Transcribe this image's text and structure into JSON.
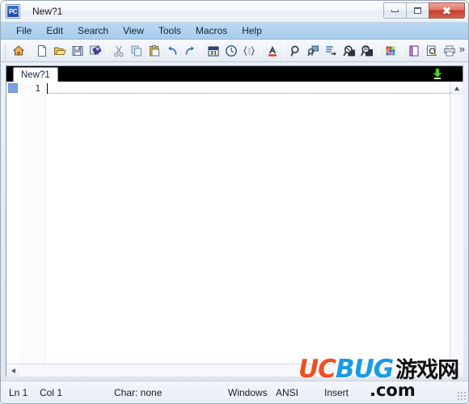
{
  "window": {
    "title": "New?1",
    "app_icon_label": "PC",
    "controls": [
      {
        "name": "minimize",
        "glyph": "minimize-icon"
      },
      {
        "name": "maximize",
        "glyph": "maximize-icon"
      },
      {
        "name": "close",
        "glyph": "✖"
      }
    ]
  },
  "menubar": {
    "items": [
      {
        "label": "File"
      },
      {
        "label": "Edit"
      },
      {
        "label": "Search"
      },
      {
        "label": "View"
      },
      {
        "label": "Tools"
      },
      {
        "label": "Macros"
      },
      {
        "label": "Help"
      }
    ]
  },
  "toolbar": {
    "overflow_label": "»",
    "groups": [
      {
        "buttons": [
          {
            "icon": "home-icon",
            "color": "#e8a33d"
          }
        ]
      },
      {
        "buttons": [
          {
            "icon": "new-file-icon",
            "color": "#ffffff"
          },
          {
            "icon": "open-folder-icon",
            "color": "#f2c14e"
          },
          {
            "icon": "save-icon",
            "color": "#8fa0b5"
          },
          {
            "icon": "save-all-icon",
            "color": "#4a3fa8"
          }
        ]
      },
      {
        "buttons": [
          {
            "icon": "cut-icon",
            "color": "#9aa3ae"
          },
          {
            "icon": "copy-icon",
            "color": "#7fa8d0"
          },
          {
            "icon": "paste-icon",
            "color": "#e0b54a"
          },
          {
            "icon": "undo-icon",
            "color": "#3a6fb5"
          },
          {
            "icon": "redo-icon",
            "color": "#3a6fb5"
          }
        ]
      },
      {
        "buttons": [
          {
            "icon": "calendar-icon",
            "color": "#2a4a8a"
          },
          {
            "icon": "clock-icon",
            "color": "#2a4a8a"
          },
          {
            "icon": "format-code-icon",
            "color": "#5a6a80"
          }
        ]
      },
      {
        "buttons": [
          {
            "icon": "text-color-icon",
            "color": "#d43f2a"
          }
        ]
      },
      {
        "buttons": [
          {
            "icon": "find-icon",
            "color": "#33404f"
          },
          {
            "icon": "find-in-files-icon",
            "color": "#4a7fc0"
          },
          {
            "icon": "goto-line-icon",
            "color": "#3a6fb5"
          },
          {
            "icon": "find-next-icon",
            "color": "#2b3542"
          },
          {
            "icon": "replace-icon",
            "color": "#2b3542"
          }
        ]
      },
      {
        "buttons": [
          {
            "icon": "color-palette-icon",
            "color": "#d43f2a"
          }
        ]
      },
      {
        "buttons": [
          {
            "icon": "page-setup-icon",
            "color": "#8a4fb5"
          },
          {
            "icon": "print-preview-icon",
            "color": "#5a6a80"
          },
          {
            "icon": "print-icon",
            "color": "#5a6a80"
          }
        ]
      }
    ]
  },
  "tabbar": {
    "tabs": [
      {
        "label": "New?1",
        "active": true
      }
    ],
    "download_icon": "download-arrow-icon",
    "download_color": "#4cd916"
  },
  "editor": {
    "lines": [
      {
        "number": "1",
        "text": ""
      }
    ],
    "bookmark_marker": "bookmark-square-icon",
    "bookmark_color": "#7ea2e0"
  },
  "statusbar": {
    "line": "Ln 1",
    "column": "Col 1",
    "char": "Char: none",
    "eol": "Windows",
    "encoding": "ANSI",
    "mode": "Insert"
  },
  "watermark": {
    "uc": "UC",
    "bug": "BUG",
    "cn": "游戏网",
    "com": ".com",
    "uc_color": "#f04e23",
    "bug_color": "#1a9ae0"
  }
}
